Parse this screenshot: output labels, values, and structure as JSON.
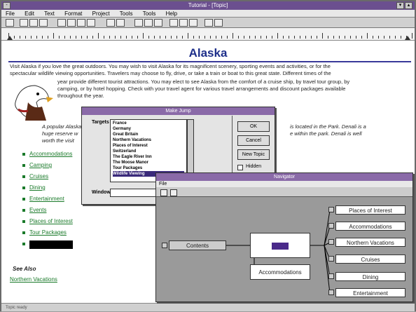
{
  "window": {
    "title": "Tutorial - [Topic]"
  },
  "menu": [
    "File",
    "Edit",
    "Text",
    "Format",
    "Project",
    "Tools",
    "Tools",
    "Help"
  ],
  "doc": {
    "title": "Alaska",
    "intro_1": "Visit Alaska if you love the great outdoors. You may wish to visit Alaska for its magnificent scenery, sporting events and activities, or for the",
    "intro_2": "spectacular wildlife viewing opportunities. Travelers may choose to fly, drive, or take a train or boat to this great state. Different times of the",
    "intro_3": "year provide different tourist attractions. You may elect to see Alaska from the comfort of a cruise ship, by travel tour group, by",
    "intro_4": "camping, or by hotel hopping. Check with your travel agent for various travel arrangements and discount packages available",
    "intro_5": "throughout the year.",
    "italic_1": "A popular Alaska",
    "italic_2": "huge reserve w",
    "italic_3": "worth the visit",
    "italic_r1": "is located in the Park. Denali is a",
    "italic_r2": "e within the park. Denali is well",
    "toc": [
      "Accommodations",
      "Camping",
      "Cruises",
      "Dining",
      "Entertainment",
      "Events",
      "Places of Interest",
      "Tour Packages"
    ],
    "see_also_label": "See Also",
    "see_also_link": "Northern Vacations",
    "status": "Topic ready"
  },
  "make_jump": {
    "title": "Make Jump",
    "targets_label": "Targets",
    "targets": [
      "France",
      "Germany",
      "Great Britain",
      "Northern Vacations",
      "Places of Interest",
      "Switzerland",
      "The Eagle River Inn",
      "The Moose Manor",
      "Tour Packages",
      "Wildlife Viewing"
    ],
    "selected_index": 9,
    "window_label": "Window",
    "ok": "OK",
    "cancel": "Cancel",
    "new_topic": "New Topic",
    "hidden": "Hidden"
  },
  "navigator": {
    "title": "Navigator",
    "menu": "File",
    "contents": "Contents",
    "center_label": "",
    "accommodations": "Accommodations",
    "right": [
      "Places of Interest",
      "Accommodations",
      "Northern Vacations",
      "Cruises",
      "Dining",
      "Entertainment"
    ]
  }
}
